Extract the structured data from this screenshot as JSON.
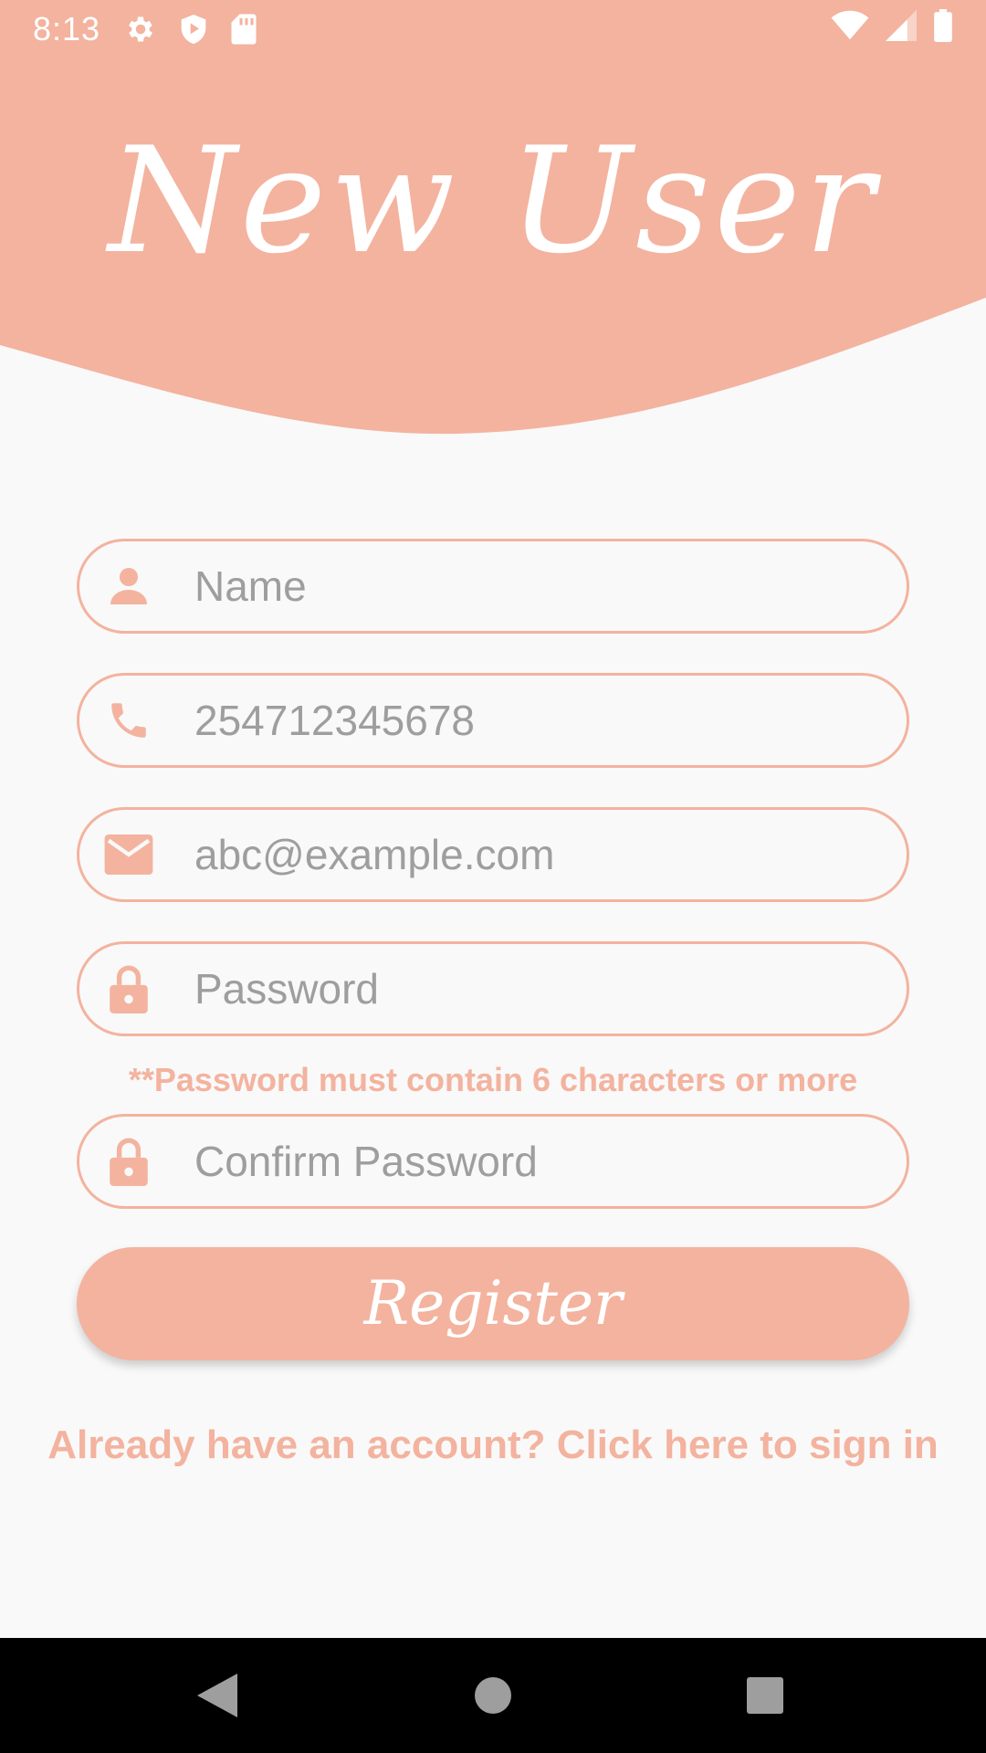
{
  "status_bar": {
    "time": "8:13"
  },
  "header": {
    "title": "New User"
  },
  "form": {
    "name": {
      "placeholder": "Name",
      "icon": "person-icon"
    },
    "phone": {
      "placeholder": "254712345678",
      "icon": "phone-icon"
    },
    "email": {
      "placeholder": "abc@example.com",
      "icon": "mail-icon"
    },
    "password": {
      "placeholder": "Password",
      "icon": "lock-icon"
    },
    "password_hint": "**Password must contain 6 characters or more",
    "confirm_password": {
      "placeholder": "Confirm Password",
      "icon": "lock-icon"
    },
    "register_label": "Register"
  },
  "footer": {
    "signin_link": "Already have an account? Click here to sign in"
  },
  "colors": {
    "accent": "#f3b39f",
    "background": "#f9f9f9",
    "placeholder": "#9e9e9e",
    "nav_bar": "#000000"
  }
}
